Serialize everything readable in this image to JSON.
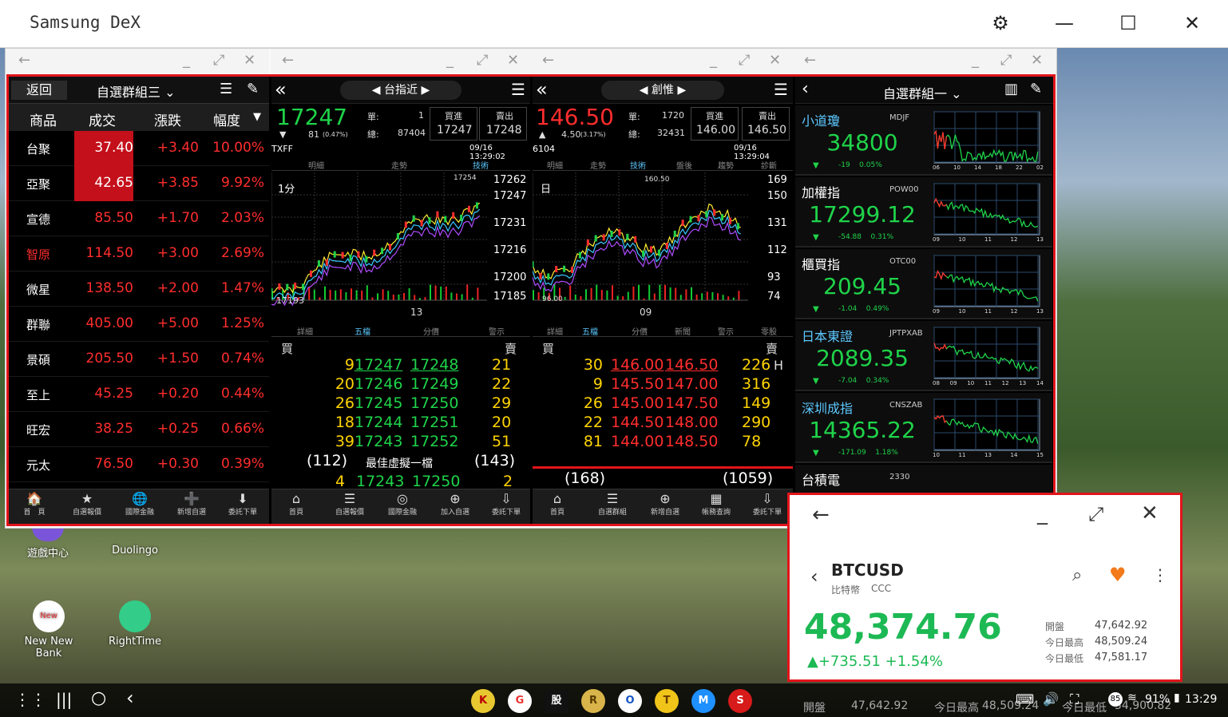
{
  "dex": {
    "title": "Samsung DeX"
  },
  "watchlist": {
    "back_label": "返回",
    "group_label": "自選群組三",
    "cols": [
      "商品",
      "成交",
      "漲跌",
      "幅度"
    ],
    "rows": [
      {
        "name": "台聚",
        "price": "37.40",
        "chg": "+3.40",
        "pct": "10.00%"
      },
      {
        "name": "亞聚",
        "price": "42.65",
        "chg": "+3.85",
        "pct": "9.92%"
      },
      {
        "name": "宣德",
        "price": "85.50",
        "chg": "+1.70",
        "pct": "2.03%"
      },
      {
        "name": "智原",
        "price": "114.50",
        "chg": "+3.00",
        "pct": "2.69%"
      },
      {
        "name": "微星",
        "price": "138.50",
        "chg": "+2.00",
        "pct": "1.47%"
      },
      {
        "name": "群聯",
        "price": "405.00",
        "chg": "+5.00",
        "pct": "1.25%"
      },
      {
        "name": "景碩",
        "price": "205.50",
        "chg": "+1.50",
        "pct": "0.74%"
      },
      {
        "name": "至上",
        "price": "45.25",
        "chg": "+0.20",
        "pct": "0.44%"
      },
      {
        "name": "旺宏",
        "price": "38.25",
        "chg": "+0.25",
        "pct": "0.66%"
      },
      {
        "name": "元太",
        "price": "76.50",
        "chg": "+0.30",
        "pct": "0.39%"
      }
    ],
    "nav": [
      "首　頁",
      "自選報價",
      "國際金融",
      "新增自選",
      "委託下單"
    ]
  },
  "txf": {
    "title": "台指近",
    "price": "17247",
    "change": "81",
    "change_pct": "(0.47%)",
    "single_label": "單:",
    "single": "1",
    "total_label": "總:",
    "total": "87404",
    "buy_label": "買進",
    "buy": "17247",
    "sell_label": "賣出",
    "sell": "17248",
    "symbol": "TXFF",
    "time": "09/16 13:29:02",
    "tabs": [
      "明細",
      "走勢",
      "技術"
    ],
    "chart_period": "1分",
    "chart_high": "17254",
    "chart_low": "17193",
    "y_ticks": [
      "17262",
      "17247",
      "17231",
      "17216",
      "17200",
      "17185"
    ],
    "x_tick": "13",
    "tabs2": [
      "詳細",
      "五檔",
      "分價",
      "警示"
    ],
    "buy_hdr": "買",
    "sell_hdr": "賣",
    "book": [
      {
        "bq": "9",
        "bp": "17247",
        "ap": "17248",
        "aq": "21"
      },
      {
        "bq": "20",
        "bp": "17246",
        "ap": "17249",
        "aq": "22"
      },
      {
        "bq": "26",
        "bp": "17245",
        "ap": "17250",
        "aq": "29"
      },
      {
        "bq": "18",
        "bp": "17244",
        "ap": "17251",
        "aq": "20"
      },
      {
        "bq": "39",
        "bp": "17243",
        "ap": "17252",
        "aq": "51"
      }
    ],
    "tot_buy": "(112)",
    "virtual_label": "最佳虛擬一檔",
    "tot_sell": "(143)",
    "virt_bq": "4",
    "virt_bp": "17243",
    "virt_ap": "17250",
    "virt_aq": "2",
    "nav": [
      "首頁",
      "自選報價",
      "國際金融",
      "加入自選",
      "委託下單"
    ]
  },
  "stock": {
    "title": "創惟",
    "price": "146.50",
    "change": "4.50",
    "change_pct": "(3.17%)",
    "single_label": "單:",
    "single": "1720",
    "total_label": "總:",
    "total": "32431",
    "buy_label": "買進",
    "buy": "146.00",
    "sell_label": "賣出",
    "sell": "146.50",
    "code": "6104",
    "time": "09/16 13:29:04",
    "tabs": [
      "明細",
      "走勢",
      "技術",
      "盤後",
      "趨勢",
      "診斷"
    ],
    "chart_period": "日",
    "chart_high": "160.50",
    "chart_low": "96.00",
    "y_ticks": [
      "169",
      "150",
      "131",
      "112",
      "93",
      "74"
    ],
    "x_tick": "09",
    "tabs2": [
      "詳細",
      "五檔",
      "分價",
      "新聞",
      "警示",
      "零股"
    ],
    "buy_hdr": "買",
    "sell_hdr": "賣",
    "book": [
      {
        "bq": "30",
        "bp": "146.00",
        "ap": "146.50",
        "aq": "226"
      },
      {
        "bq": "9",
        "bp": "145.50",
        "ap": "147.00",
        "aq": "316"
      },
      {
        "bq": "26",
        "bp": "145.00",
        "ap": "147.50",
        "aq": "149"
      },
      {
        "bq": "22",
        "bp": "144.50",
        "ap": "148.00",
        "aq": "290"
      },
      {
        "bq": "81",
        "bp": "144.00",
        "ap": "148.50",
        "aq": "78"
      }
    ],
    "limit_mark": "H",
    "tot_buy": "(168)",
    "tot_sell": "(1059)",
    "nav": [
      "首頁",
      "自選群組",
      "新增自選",
      "帳務查詢",
      "委託下單"
    ]
  },
  "indices": {
    "group_label": "自選群組一",
    "tiles": [
      {
        "name": "小道瓊",
        "code": "MDJF",
        "value": "34800",
        "chg": "-19",
        "pct": "0.05%",
        "x_ticks": [
          "06",
          "10",
          "14",
          "18",
          "22",
          "02"
        ]
      },
      {
        "name": "加權指",
        "code": "POW00",
        "value": "17299.12",
        "chg": "-54.88",
        "pct": "0.31%",
        "x_ticks": [
          "09",
          "10",
          "11",
          "12",
          "13"
        ]
      },
      {
        "name": "櫃買指",
        "code": "OTC00",
        "value": "209.45",
        "chg": "-1.04",
        "pct": "0.49%",
        "x_ticks": [
          "09",
          "10",
          "11",
          "12",
          "13"
        ]
      },
      {
        "name": "日本東證",
        "code": "JPTPXAB",
        "value": "2089.35",
        "chg": "-7.04",
        "pct": "0.34%",
        "x_ticks": [
          "08",
          "09",
          "10",
          "11",
          "12",
          "13",
          "14"
        ]
      },
      {
        "name": "深圳成指",
        "code": "CNSZAB",
        "value": "14365.22",
        "chg": "-171.09",
        "pct": "1.18%",
        "x_ticks": [
          "10",
          "11",
          "13",
          "14",
          "15"
        ]
      },
      {
        "name": "台積電",
        "code": "2330",
        "value": "",
        "chg": "",
        "pct": "",
        "x_ticks": []
      }
    ]
  },
  "btc": {
    "symbol": "BTCUSD",
    "sub": "比特幣",
    "exchange": "CCC",
    "price": "48,374.76",
    "change": "+735.51",
    "change_pct": "+1.54%",
    "open_label": "開盤",
    "open": "47,642.92",
    "high_label": "今日最高",
    "high": "48,509.24",
    "low_label": "今日最低",
    "low": "47,581.17"
  },
  "behind": {
    "open_label": "開盤",
    "open": "47,642.92",
    "high_label": "今日最高",
    "high": "48,509.24",
    "low_label": "今日最低",
    "low": "54,900.82"
  },
  "desktop": {
    "icons": [
      "遊戲中心",
      "Duolingo",
      "New New Bank",
      "RightTime"
    ]
  },
  "taskbar": {
    "apps": [
      "K",
      "G",
      "股",
      "R",
      "O",
      "T",
      "M",
      "S"
    ],
    "battery": "91%",
    "time": "13:29",
    "notif": "85"
  }
}
